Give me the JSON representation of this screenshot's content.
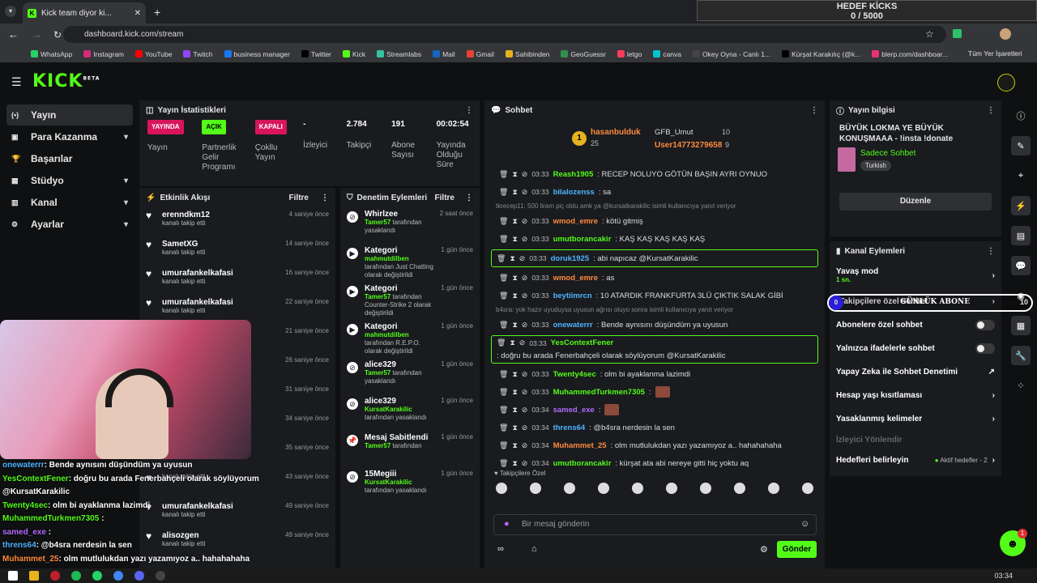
{
  "browser": {
    "tab_title": "Kick team diyor ki...",
    "url": "dashboard.kick.com/stream",
    "bookmarks": [
      "WhatsApp",
      "Instagram",
      "YouTube",
      "Twitch",
      "business manager",
      "Twitter",
      "Kick",
      "Streamlabs",
      "Mail",
      "Gmail",
      "Sahibinden",
      "GeoGuessr",
      "letgo",
      "canva",
      "Okey Oyna - Canlı 1...",
      "Kürşat Karakılıç (@k...",
      "blerp.com/dashboar..."
    ],
    "bookmarks_folder": "Tüm Yer İşaretleri"
  },
  "hedef": {
    "title": "HEDEF KİCKS",
    "value": "0 / 5000"
  },
  "logo": "KICK",
  "logo_beta": "BETA",
  "sidebar": [
    {
      "label": "Yayın",
      "icon": "broadcast-icon",
      "chev": false
    },
    {
      "label": "Para Kazanma",
      "icon": "money-icon",
      "chev": true
    },
    {
      "label": "Başarılar",
      "icon": "trophy-icon",
      "chev": false
    },
    {
      "label": "Stüdyo",
      "icon": "studio-icon",
      "chev": true
    },
    {
      "label": "Kanal",
      "icon": "channel-icon",
      "chev": true
    },
    {
      "label": "Ayarlar",
      "icon": "settings-icon",
      "chev": true
    }
  ],
  "stats": {
    "title": "Yayın İstatistikleri",
    "items": [
      {
        "badge": "YAYINDA",
        "badge_color": "#d8155a",
        "label": "Yayın"
      },
      {
        "badge": "AÇIK",
        "badge_color": "#53fc18",
        "label": "Partnerlik Gelir Programı"
      },
      {
        "badge": "KAPALI",
        "badge_color": "#d8155a",
        "label": "Çokllu Yayın"
      },
      {
        "value": "-",
        "label": "İzleyici"
      },
      {
        "value": "2.784",
        "label": "Takipçi"
      },
      {
        "value": "191",
        "label": "Abone Sayısı"
      },
      {
        "value": "00:02:54",
        "label": "Yayında Olduğu Süre"
      }
    ]
  },
  "activity": {
    "title": "Etkinlik Akışı",
    "filter": "Filtre",
    "items": [
      {
        "name": "erenndkm12",
        "sub": "kanalı takip etti",
        "time": "4 saniye önce"
      },
      {
        "name": "SametXG",
        "sub": "kanalı takip etti",
        "time": "14 saniye önce"
      },
      {
        "name": "umurafankelkafasi",
        "sub": "kanalı takip etti",
        "time": "16 saniye önce"
      },
      {
        "name": "umurafankelkafasi",
        "sub": "kanalı takip etti",
        "time": "22 saniye önce"
      },
      {
        "name": "",
        "sub": "",
        "time": "21 saniye önce"
      },
      {
        "name": "",
        "sub": "",
        "time": "26 saniye önce"
      },
      {
        "name": "",
        "sub": "",
        "time": "31 saniye önce"
      },
      {
        "name": "",
        "sub": "",
        "time": "34 saniye önce"
      },
      {
        "name": "",
        "sub": "",
        "time": "35 saniye önce"
      },
      {
        "name": "",
        "sub": "kanalı takip etti",
        "time": "43 saniye önce"
      },
      {
        "name": "umurafankelkafasi",
        "sub": "kanalı takip etti",
        "time": "49 saniye önce"
      },
      {
        "name": "alisozgen",
        "sub": "kanalı takip etti",
        "time": "49 saniye önce"
      }
    ]
  },
  "modlog": {
    "title": "Denetim Eylemleri",
    "filter": "Filtre",
    "items": [
      {
        "name": "Whirlzee",
        "user": "Tamer57",
        "rest": " tarafından yasaklandı",
        "time": "2 saat önce",
        "icon": "ban-icon"
      },
      {
        "name": "Kategori",
        "user": "mahmutdilben",
        "rest": " tarafından Just Chatting olarak değiştirildi",
        "time": "1 gün önce",
        "icon": "category-icon"
      },
      {
        "name": "Kategori",
        "user": "Tamer57",
        "rest": " tarafından Counter-Strike 2 olarak değiştirildi",
        "time": "1 gün önce",
        "icon": "category-icon"
      },
      {
        "name": "Kategori",
        "user": "mahmutdilben",
        "rest": " tarafından R.E.P.O. olarak değiştirildi",
        "time": "1 gün önce",
        "icon": "category-icon"
      },
      {
        "name": "alice329",
        "user": "Tamer57",
        "rest": " tarafından yasaklandı",
        "time": "1 gün önce",
        "icon": "ban-icon"
      },
      {
        "name": "alice329",
        "user": "KursatKarakilic",
        "rest": " tarafından yasaklandı",
        "time": "1 gün önce",
        "icon": "ban-icon"
      },
      {
        "name": "Mesaj Sabitlendi",
        "user": "Tamer57",
        "rest": " tarafından",
        "time": "1 gün önce",
        "icon": "pin-icon"
      },
      {
        "name": "15Megiii",
        "user": "KursatKarakilic",
        "rest": " tarafından yasaklandı",
        "time": "1 gün önce",
        "icon": "ban-icon"
      }
    ]
  },
  "chat": {
    "title": "Sohbet",
    "leaders": {
      "first": {
        "rank": "1",
        "name": "hasanbulduk",
        "count": "25"
      },
      "second": {
        "name": "GFB_Umut",
        "count": "10"
      },
      "third": {
        "name": "User14773279658",
        "count": "9"
      }
    },
    "lines": [
      {
        "t": "03:33",
        "u": "Reash1905",
        "c": "#53fc18",
        "m": ": RECEP NOLUYO GÖTÜN BAŞIN AYRI OYNUO",
        "hl": false,
        "emote": false
      },
      {
        "t": "03:33",
        "u": "bilalozenss",
        "c": "#4fb3ff",
        "m": ": sa",
        "hl": false,
        "emote": false
      },
      {
        "sys": "tkrecep11: 500 liram piç oldu amk ya @kursatkarakilic isimli kullanıcıya yanıt veriyor"
      },
      {
        "t": "03:33",
        "u": "wmod_emre",
        "c": "#ff8a3d",
        "m": ": kötü gitmiş",
        "hl": false,
        "emote": false
      },
      {
        "t": "03:33",
        "u": "umutborancakir",
        "c": "#53fc18",
        "m": ": KAŞ KAŞ KAŞ KAŞ KAŞ",
        "hl": false,
        "emote": false
      },
      {
        "t": "03:33",
        "u": "doruk1925",
        "c": "#4fb3ff",
        "m": ": abi napıcaz @KursatKarakilic",
        "hl": true,
        "emote": false
      },
      {
        "t": "03:33",
        "u": "wmod_emre",
        "c": "#ff8a3d",
        "m": ": as",
        "hl": false,
        "emote": false
      },
      {
        "t": "03:33",
        "u": "beytiimrcn",
        "c": "#4fb3ff",
        "m": ": 10 ATARDIK FRANKFURTA 3LÜ ÇIKTIK SALAK GİBİ",
        "hl": false,
        "emote": false
      },
      {
        "sys": "b4sra: yok hazır uyuduysa uyusun ağrısı oluyo sonra isimli kullanıcıya yanıt veriyor"
      },
      {
        "t": "03:33",
        "u": "onewaterrr",
        "c": "#4fb3ff",
        "m": ": Bende aynısını düşündüm ya uyusun",
        "hl": false,
        "emote": false
      },
      {
        "t": "03:33",
        "u": "YesContextFener",
        "c": "#53fc18",
        "m": ": doğru bu arada Fenerbahçeli olarak söylüyorum @KursatKarakilic",
        "hl": true,
        "emote": false
      },
      {
        "t": "03:33",
        "u": "Twenty4sec",
        "c": "#53fc18",
        "m": ": olm bi ayaklanma lazimdi",
        "hl": false,
        "emote": false
      },
      {
        "t": "03:33",
        "u": "MuhammedTurkmen7305",
        "c": "#53fc18",
        "m": ":",
        "hl": false,
        "emote": true
      },
      {
        "t": "03:34",
        "u": "samed_exe",
        "c": "#b46bff",
        "m": ":",
        "hl": false,
        "emote": true
      },
      {
        "t": "03:34",
        "u": "threns64",
        "c": "#4fb3ff",
        "m": ": @b4sra nerdesin la sen",
        "hl": false,
        "emote": false
      },
      {
        "t": "03:34",
        "u": "Muhammet_25",
        "c": "#ff8a3d",
        "m": ": olm mutlulukdan yazı yazamıyoz a.. hahahahaha",
        "hl": false,
        "emote": false
      },
      {
        "t": "03:34",
        "u": "umutborancakir",
        "c": "#53fc18",
        "m": ": kürşat ata abi nereye gitti hiç yoktu aq",
        "hl": false,
        "emote": false
      }
    ],
    "followers_only": "Takipçilere Özel",
    "placeholder": "Bir mesaj gönderin",
    "send": "Gönder"
  },
  "info": {
    "title": "Yayın bilgisi",
    "stream_title": "BÜYÜK LOKMA YE BÜYÜK KONUŞMAAA - !insta !donate",
    "category": "Sadece Sohbet",
    "tag": "Turkish",
    "edit": "Düzenle"
  },
  "actions": {
    "title": "Kanal Eylemleri",
    "slow": "Yavaş mod",
    "slow_val": "1 sn.",
    "followers": "Takipçilere özel sohbet",
    "subs": "Abonelere özel sohbet",
    "emotes": "Yalnızca ifadelerle sohbet",
    "ai": "Yapay Zeka ile Sohbet Denetimi",
    "age": "Hesap yaşı kısıtlaması",
    "banned": "Yasaklanmış kelimeler",
    "redirect": "İzleyici Yönlendir",
    "goals": "Hedefleri belirleyin",
    "goals_status": "Aktif hedefler - 2"
  },
  "overlay_goal": {
    "count": "0",
    "label": "GÜNLÜK ABONE",
    "total": "10"
  },
  "overlay_chat": [
    {
      "u": "onewaterrr",
      "c": "#4fb3ff",
      "m": ": Bende aynısını düşündüm ya uyusun"
    },
    {
      "u": "YesContextFener",
      "c": "#53fc18",
      "m": ": doğru bu arada Fenerbahçeli olarak söylüyorum @KursatKarakilic"
    },
    {
      "u": "Twenty4sec",
      "c": "#53fc18",
      "m": ": olm bi ayaklanma lazimdi"
    },
    {
      "u": "MuhammedTurkmen7305",
      "c": "#53fc18",
      "m": " :"
    },
    {
      "u": "samed_exe",
      "c": "#b46bff",
      "m": " :"
    },
    {
      "u": "threns64",
      "c": "#4fb3ff",
      "m": ": @b4sra nerdesin la sen"
    },
    {
      "u": "Muhammet_25",
      "c": "#ff8a3d",
      "m": ": olm mutlulukdan yazı yazamıyoz a.. hahahahaha"
    }
  ],
  "clock": "03:34",
  "chat_badge": "1"
}
